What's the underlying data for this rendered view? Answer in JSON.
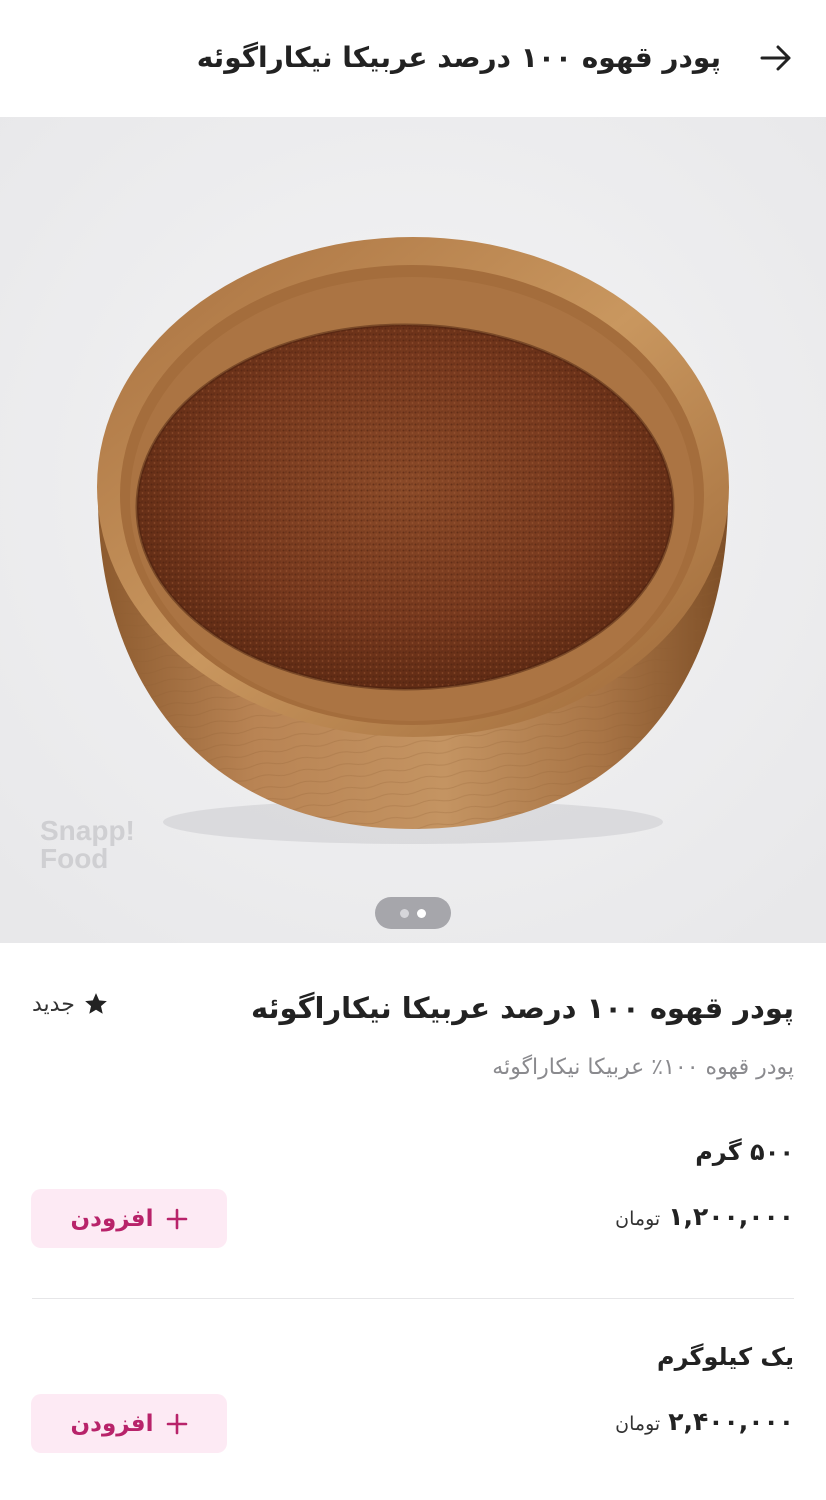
{
  "header": {
    "title": "پودر قهوه ۱۰۰ درصد عربیکا نیکاراگوئه",
    "back_icon": "arrow-right-icon"
  },
  "gallery": {
    "watermark_line1": "Snapp!",
    "watermark_line2": "Food",
    "page_count": 2,
    "active_page": 2
  },
  "product": {
    "title": "پودر قهوه ۱۰۰ درصد عربیکا نیکاراگوئه",
    "badge_label": "جدید",
    "badge_icon": "star-icon",
    "subtitle": "پودر قهوه ۱۰۰٪ عربیکا نیکاراگوئه"
  },
  "variants": [
    {
      "name": "۵۰۰ گرم",
      "price": "۱,۲۰۰,۰۰۰",
      "currency": "تومان",
      "add_label": "افزودن",
      "add_icon": "plus-icon"
    },
    {
      "name": "یک کیلوگرم",
      "price": "۲,۴۰۰,۰۰۰",
      "currency": "تومان",
      "add_label": "افزودن",
      "add_icon": "plus-icon"
    }
  ],
  "colors": {
    "accent": "#b8236a",
    "add_button_bg": "#fdeaf4",
    "gallery_bg": "#eeeeef"
  }
}
